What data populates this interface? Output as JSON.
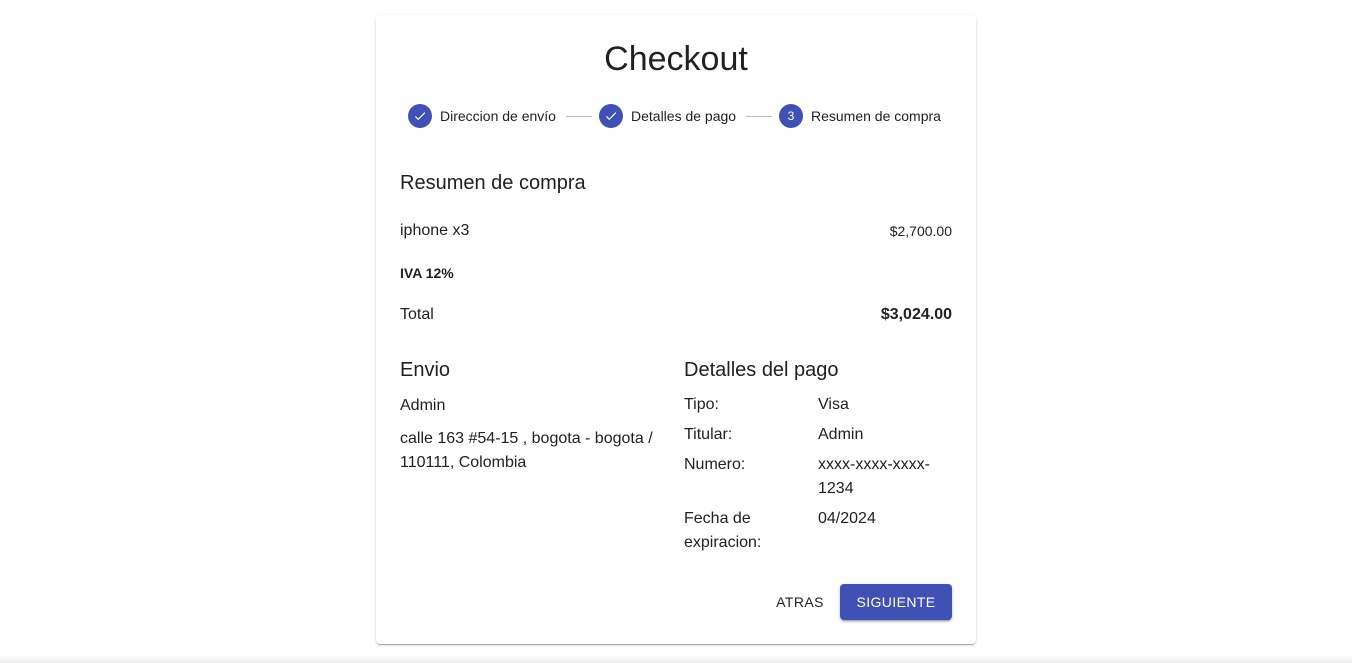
{
  "title": "Checkout",
  "steps": [
    {
      "label": "Direccion de envío",
      "state": "completed",
      "icon": "check-icon"
    },
    {
      "label": "Detalles de pago",
      "state": "completed",
      "icon": "check-icon"
    },
    {
      "label": "Resumen de compra",
      "state": "active",
      "number": "3"
    }
  ],
  "summary": {
    "heading": "Resumen de compra",
    "items": [
      {
        "name": "iphone x3",
        "price": "$2,700.00"
      }
    ],
    "tax_label": "IVA 12%",
    "total_label": "Total",
    "total_value": "$3,024.00"
  },
  "shipping": {
    "heading": "Envio",
    "name": "Admin",
    "address": "calle 163 #54-15 , bogota - bogota / 110111, Colombia"
  },
  "payment": {
    "heading": "Detalles del pago",
    "rows": [
      {
        "label": "Tipo:",
        "value": "Visa"
      },
      {
        "label": "Titular:",
        "value": "Admin"
      },
      {
        "label": "Numero:",
        "value": "xxxx-xxxx-xxxx-1234"
      },
      {
        "label": "Fecha de expiracion:",
        "value": "04/2024"
      }
    ]
  },
  "actions": {
    "back_label": "Atras",
    "next_label": "Siguiente"
  },
  "colors": {
    "primary": "#3f51b5",
    "text": "#212121",
    "connector": "#bdbdbd"
  }
}
